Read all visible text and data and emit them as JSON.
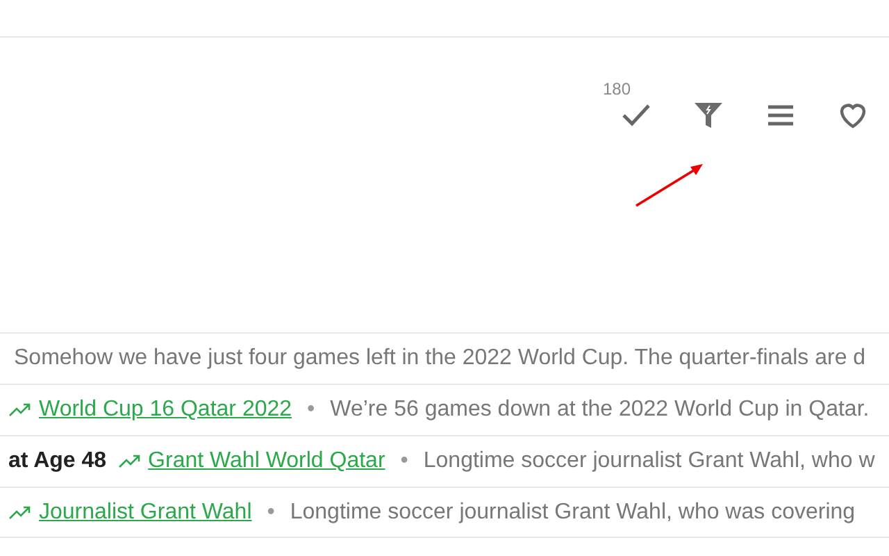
{
  "toolbar": [
    {
      "kind": "check",
      "count": "180"
    },
    {
      "kind": "filter"
    },
    {
      "kind": "menu"
    },
    {
      "kind": "heart"
    }
  ],
  "results": [
    {
      "text": "Somehow we have just four games left in the 2022 World Cup. The quarter-finals are d"
    },
    {
      "tag": "World Cup 16 Qatar 2022",
      "separator": "•",
      "text": "We’re 56 games down at the 2022 World Cup in Qatar."
    },
    {
      "title": "at Age 48",
      "tag": "Grant Wahl World Qatar",
      "separator": "•",
      "text": "Longtime soccer journalist Grant Wahl, who w"
    },
    {
      "tag": "Journalist Grant Wahl",
      "separator": "•",
      "text": "Longtime soccer journalist Grant Wahl, who was covering"
    }
  ]
}
